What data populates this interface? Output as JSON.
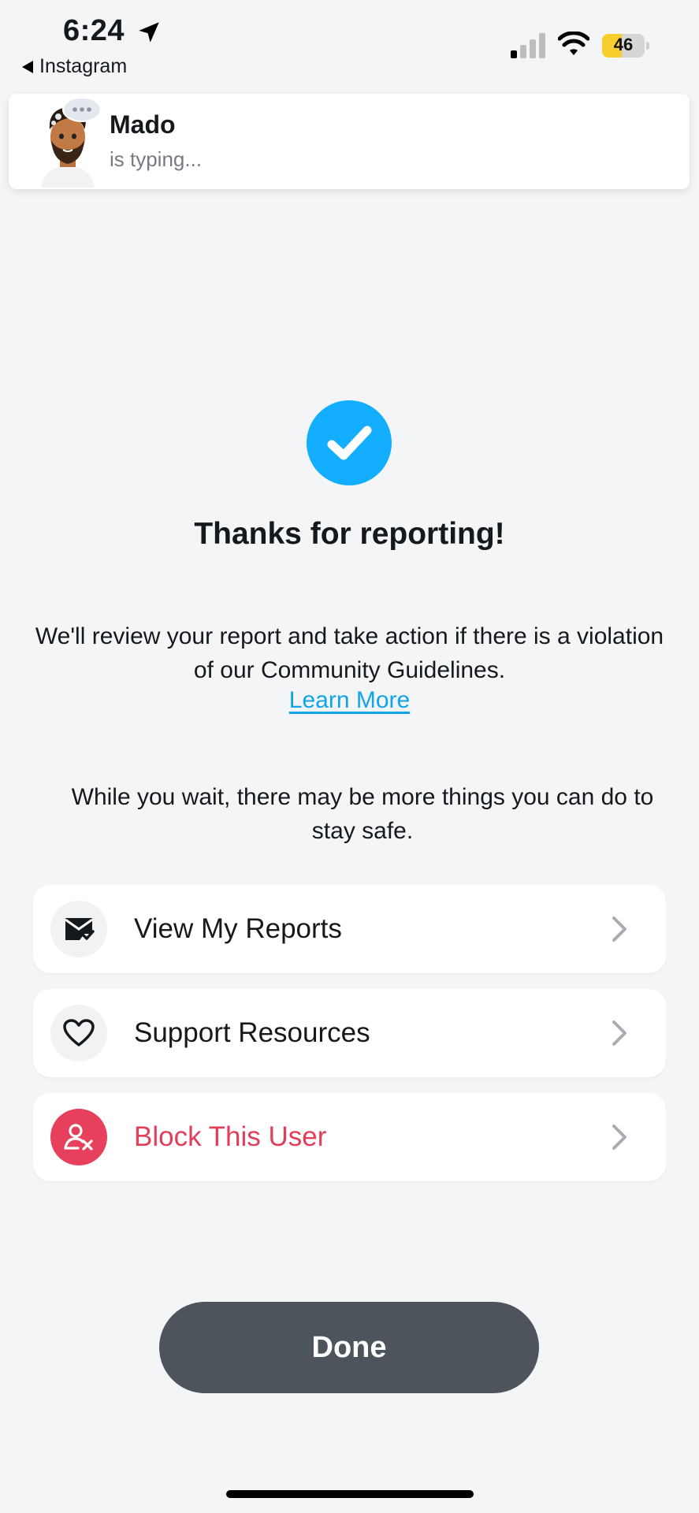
{
  "status_bar": {
    "time": "6:24",
    "back_app": "Instagram",
    "battery": "46",
    "battery_level_percent": 46,
    "signal_bars_active": 1
  },
  "notification": {
    "name": "Mado",
    "status": "is typing..."
  },
  "confirmation": {
    "title": "Thanks for reporting!",
    "body": "We'll review your report and take action if there is a violation of our Community Guidelines.",
    "link": "Learn More",
    "wait_text": "While you wait, there may be more things you can do to stay safe."
  },
  "actions": [
    {
      "label": "View My Reports",
      "icon": "mail-check-icon"
    },
    {
      "label": "Support Resources",
      "icon": "heart-icon"
    },
    {
      "label": "Block This User",
      "icon": "block-user-icon"
    }
  ],
  "done_label": "Done",
  "colors": {
    "accent_blue": "#13aeff",
    "danger_red": "#e23e5a",
    "done_button": "#4d545c",
    "background": "#f4f5f7"
  }
}
